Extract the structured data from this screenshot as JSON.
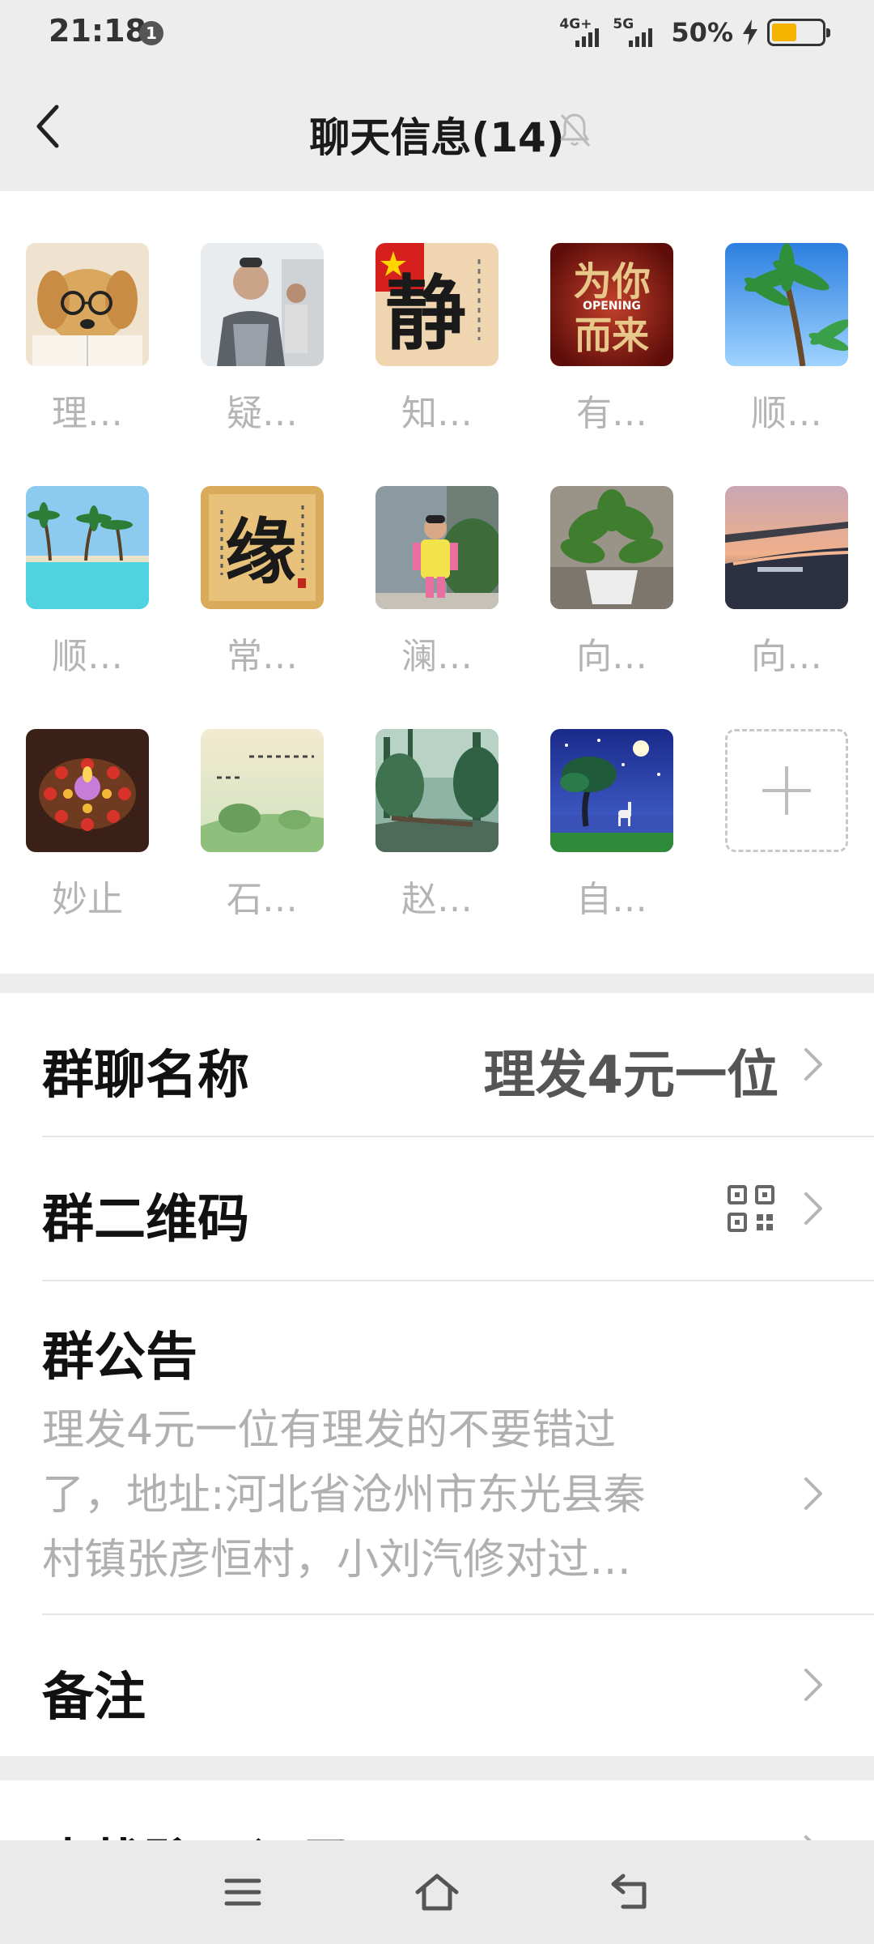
{
  "status_bar": {
    "time": "21:18",
    "notification_count": "1",
    "network_1": "4G+",
    "network_2": "5G",
    "battery": "50%",
    "battery_level": 0.5
  },
  "header": {
    "title": "聊天信息(14)",
    "back_icon": "chevron-left-icon",
    "mute_icon": "bell-muted-icon"
  },
  "members": [
    {
      "name": "理…",
      "avatar": "dog-with-glasses"
    },
    {
      "name": "疑…",
      "avatar": "man-portrait"
    },
    {
      "name": "知…",
      "avatar": "calligraphy-jing"
    },
    {
      "name": "有…",
      "avatar": "opening-calligraphy"
    },
    {
      "name": "顺…",
      "avatar": "palm-trees"
    },
    {
      "name": "顺…",
      "avatar": "beach-pool"
    },
    {
      "name": "常…",
      "avatar": "calligraphy-yuan"
    },
    {
      "name": "澜…",
      "avatar": "child-photo"
    },
    {
      "name": "向…",
      "avatar": "potted-plant"
    },
    {
      "name": "向…",
      "avatar": "sunset-river"
    },
    {
      "name": "妙止",
      "avatar": "candles"
    },
    {
      "name": "石…",
      "avatar": "landscape-text"
    },
    {
      "name": "赵…",
      "avatar": "forest-mist"
    },
    {
      "name": "自…",
      "avatar": "night-tree-deer"
    }
  ],
  "add_member_icon": "plus-icon",
  "group_name": {
    "label": "群聊名称",
    "value": "理发4元一位"
  },
  "group_qr": {
    "label": "群二维码",
    "icon": "qr-code-icon"
  },
  "announcement": {
    "label": "群公告",
    "line1": "理发4元一位有理发的不要错过",
    "line2": "了，地址:河北省沧州市东光县秦",
    "line3": "村镇张彦恒村，小刘汽修对过…"
  },
  "remark": {
    "label": "备注"
  },
  "search_history": {
    "label": "查找聊天记录"
  },
  "nav": {
    "menu_icon": "menu-icon",
    "home_icon": "home-icon",
    "back_icon": "back-arrow-icon"
  }
}
